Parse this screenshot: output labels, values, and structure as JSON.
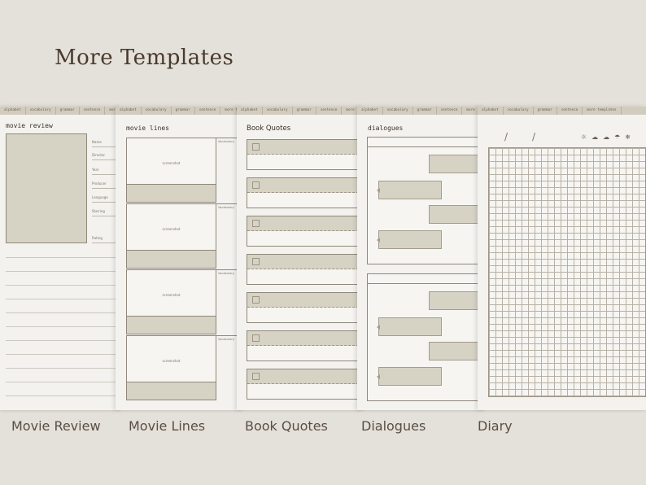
{
  "heading": "More Templates",
  "tabs": [
    "alphabet",
    "vocabulary",
    "grammar",
    "sentence",
    "more templates"
  ],
  "pages": [
    {
      "label": "Movie Review",
      "title": "movie review",
      "fields": [
        "Name",
        "Director",
        "Year",
        "Producer",
        "Language",
        "Starring",
        "Rating"
      ]
    },
    {
      "label": "Movie Lines",
      "title": "movie lines",
      "frame_text": "screenshot",
      "vocab_label": "Vocabulary"
    },
    {
      "label": "Book Quotes",
      "title": "Book Quotes"
    },
    {
      "label": "Dialogues",
      "title": "dialogues"
    },
    {
      "label": "Diary",
      "date_separator": "/",
      "weather_icons": [
        "sun-icon",
        "cloud-sun-icon",
        "cloud-icon",
        "rain-icon",
        "snow-icon"
      ]
    }
  ],
  "colors": {
    "background": "#e4e1da",
    "paper": "#f3f2ef",
    "accent": "#d6d3c5",
    "ink": "#3c3128"
  }
}
